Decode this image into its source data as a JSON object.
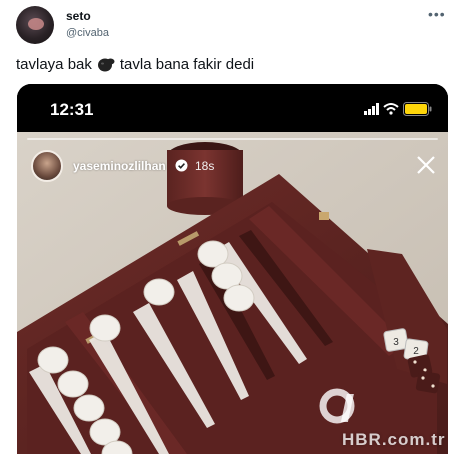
{
  "tweet": {
    "display_name": "seto",
    "handle": "@civaba",
    "more_icon": "more-icon",
    "text_before": "tavlaya bak",
    "emoji": "smoking-face-emoji",
    "text_after": "tavla bana fakir dedi"
  },
  "media": {
    "status_bar": {
      "time": "12:31",
      "icons": [
        "signal-icon",
        "wifi-icon",
        "battery-icon"
      ],
      "battery_color": "#ffd60a"
    },
    "story": {
      "username": "yaseminozlilhan",
      "verified": true,
      "age": "18s",
      "close_icon": "close-icon"
    },
    "dice_values": [
      "3",
      "2"
    ],
    "watermark": "HBR.com.tr"
  }
}
